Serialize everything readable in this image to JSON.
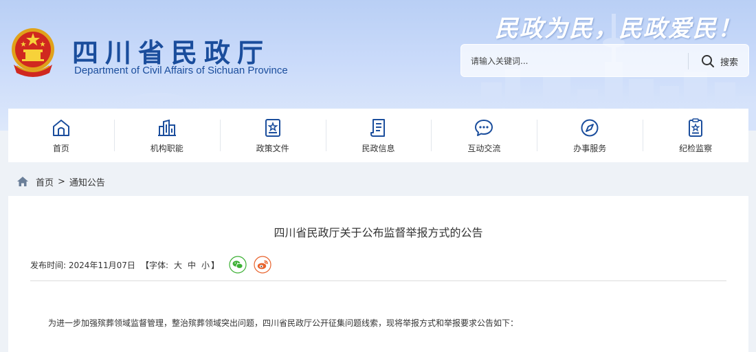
{
  "header": {
    "title_cn": "四川省民政厅",
    "title_en": "Department of Civil Affairs of Sichuan Province",
    "slogan": "民政为民，民政爱民！",
    "search": {
      "placeholder": "请输入关键词...",
      "button_label": "搜索"
    }
  },
  "nav": {
    "items": [
      {
        "label": "首页",
        "icon": "home-icon"
      },
      {
        "label": "机构职能",
        "icon": "building-icon"
      },
      {
        "label": "政策文件",
        "icon": "policy-document-icon"
      },
      {
        "label": "民政信息",
        "icon": "news-document-icon"
      },
      {
        "label": "互动交流",
        "icon": "chat-bubble-icon"
      },
      {
        "label": "办事服务",
        "icon": "compass-icon"
      },
      {
        "label": "纪检监察",
        "icon": "badge-clipboard-icon"
      }
    ]
  },
  "breadcrumb": {
    "home": "首页",
    "separator": ">",
    "current": "通知公告"
  },
  "article": {
    "title": "四川省民政厅关于公布监督举报方式的公告",
    "publish_label": "发布时间: 2024年11月07日",
    "font_label_open": "【字体:",
    "font_large": "大",
    "font_medium": "中",
    "font_small": "小",
    "font_label_close": "】",
    "paragraph_1": "为进一步加强殡葬领域监督管理，整治殡葬领域突出问题，四川省民政厅公开征集问题线索，现将举报方式和举报要求公告如下："
  },
  "colors": {
    "brand_blue": "#1a4d9c",
    "wechat_green": "#3cb034",
    "weibo_orange": "#e8622c"
  }
}
